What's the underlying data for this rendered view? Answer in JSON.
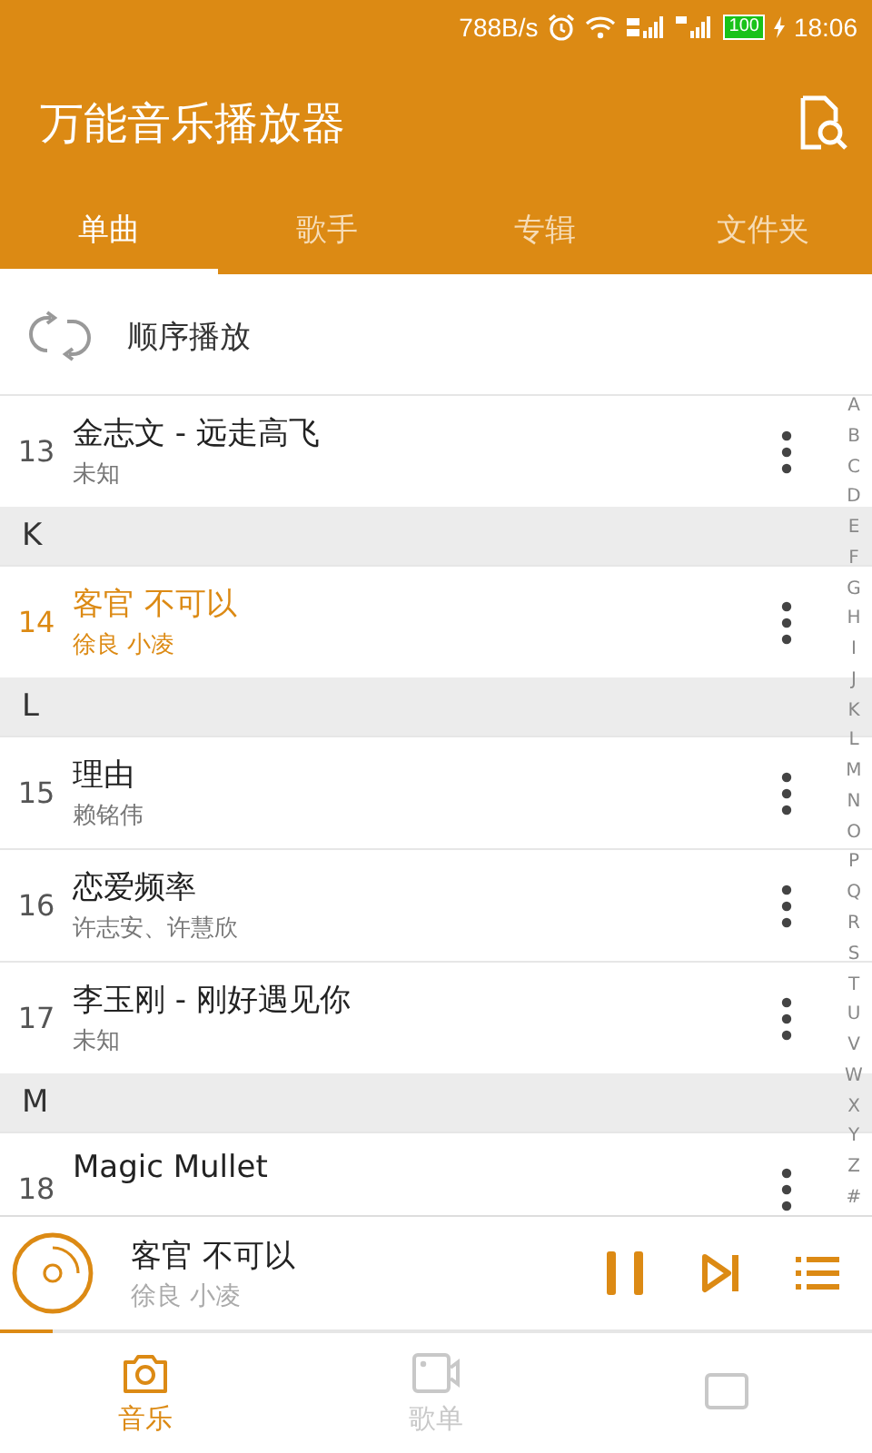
{
  "status_bar": {
    "speed": "788B/s",
    "battery": "100",
    "time": "18:06"
  },
  "app_bar": {
    "title": "万能音乐播放器"
  },
  "tabs": [
    {
      "label": "单曲",
      "selected": true
    },
    {
      "label": "歌手",
      "selected": false
    },
    {
      "label": "专辑",
      "selected": false
    },
    {
      "label": "文件夹",
      "selected": false
    }
  ],
  "play_mode": {
    "label": "顺序播放"
  },
  "list": [
    {
      "kind": "song",
      "number": "13",
      "title": "金志文 - 远走高飞",
      "artist": "未知",
      "selected": false
    },
    {
      "kind": "header",
      "letter": "K"
    },
    {
      "kind": "song",
      "number": "14",
      "title": "客官 不可以",
      "artist": "徐良 小凌",
      "selected": true
    },
    {
      "kind": "header",
      "letter": "L"
    },
    {
      "kind": "song",
      "number": "15",
      "title": "理由",
      "artist": "赖铭伟",
      "selected": false
    },
    {
      "kind": "song",
      "number": "16",
      "title": "恋爱频率",
      "artist": "许志安、许慧欣",
      "selected": false
    },
    {
      "kind": "song",
      "number": "17",
      "title": "李玉刚 - 刚好遇见你",
      "artist": "未知",
      "selected": false
    },
    {
      "kind": "header",
      "letter": "M"
    },
    {
      "kind": "song",
      "number": "18",
      "title": "Magic Mullet",
      "selected": false
    }
  ],
  "index_bar": [
    "A",
    "B",
    "C",
    "D",
    "E",
    "F",
    "G",
    "H",
    "I",
    "J",
    "K",
    "L",
    "M",
    "N",
    "O",
    "P",
    "Q",
    "R",
    "S",
    "T",
    "U",
    "V",
    "W",
    "X",
    "Y",
    "Z",
    "#"
  ],
  "now_playing": {
    "title": "客官 不可以",
    "artist": "徐良 小凌",
    "playing": true,
    "level": 0.06
  },
  "bottom_nav": [
    {
      "kind": "music",
      "label": "音乐",
      "selected": true
    },
    {
      "kind": "playlist",
      "label": "歌单",
      "selected": false
    },
    {
      "kind": "screen",
      "selected": false
    }
  ]
}
